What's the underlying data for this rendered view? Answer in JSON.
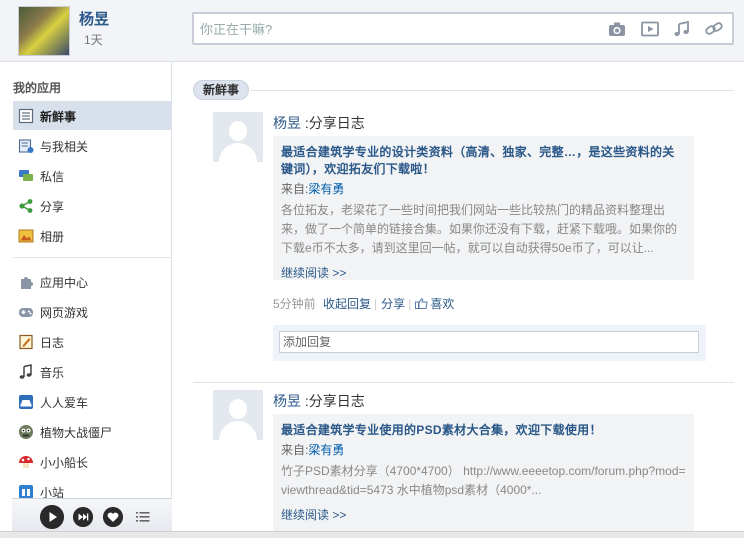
{
  "header": {
    "user_name": "杨昱",
    "days": "1天",
    "status_placeholder": "你正在干嘛?"
  },
  "sidebar": {
    "title": "我的应用",
    "items": [
      {
        "label": "新鲜事",
        "icon": "news-feed-icon",
        "active": true
      },
      {
        "label": "与我相关",
        "icon": "related-icon"
      },
      {
        "label": "私信",
        "icon": "message-icon"
      },
      {
        "label": "分享",
        "icon": "share-icon"
      },
      {
        "label": "相册",
        "icon": "album-icon"
      },
      {
        "label": "应用中心",
        "icon": "app-center-icon"
      },
      {
        "label": "网页游戏",
        "icon": "gamepad-icon"
      },
      {
        "label": "日志",
        "icon": "journal-icon"
      },
      {
        "label": "音乐",
        "icon": "music-note-icon"
      },
      {
        "label": "人人爱车",
        "icon": "car-icon"
      },
      {
        "label": "植物大战僵尸",
        "icon": "zombie-icon"
      },
      {
        "label": "小小船长",
        "icon": "mushroom-icon"
      },
      {
        "label": "小站",
        "icon": "station-icon"
      }
    ]
  },
  "feed": {
    "tab": "新鲜事",
    "posts": [
      {
        "author": "杨昱",
        "action": " :分享日志",
        "title": "最适合建筑学专业的设计类资料（高清、独家、完整…，是这些资料的关键词），欢迎拓友们下载啦！",
        "source_prefix": "来自:",
        "source": "梁有勇",
        "body": "各位拓友，老梁花了一些时间把我们网站一些比较热门的精品资料整理出来，做了一个简单的链接合集。如果你还没有下载，赶紧下载哦。如果你的下载e币不太多，请到这里回一帖，就可以自动获得50e币了，可以让...",
        "more": "继续阅读 >>",
        "time": "5分钟前",
        "collapse": "收起回复",
        "share": "分享",
        "like": "喜欢",
        "reply_placeholder": "添加回复"
      },
      {
        "author": "杨昱",
        "action": " :分享日志",
        "title": "最适合建筑学专业使用的PSD素材大合集，欢迎下载使用！",
        "source_prefix": "来自:",
        "source": "梁有勇",
        "body": "竹子PSD素材分享（4700*4700） http://www.eeeetop.com/forum.php?mod=viewthread&tid=5473 水中植物psd素材（4000*...",
        "more": "继续阅读 >>"
      }
    ]
  },
  "colors": {
    "link": "#2a5888",
    "active_bg": "#d8e0ec",
    "card_bg": "#f2f3f5"
  }
}
